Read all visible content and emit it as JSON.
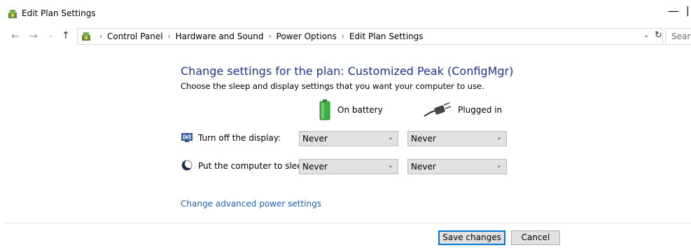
{
  "window": {
    "title": "Edit Plan Settings",
    "minimize_glyph": "—",
    "maximize_glyph": "|"
  },
  "nav": {
    "back_glyph": "←",
    "forward_glyph": "→",
    "recent_glyph": "⌄",
    "up_glyph": "↑",
    "breadcrumbs": [
      "Control Panel",
      "Hardware and Sound",
      "Power Options",
      "Edit Plan Settings"
    ],
    "separator": "›",
    "dropdown_glyph": "⌄",
    "refresh_glyph": "↻",
    "search_placeholder": "Searc"
  },
  "content": {
    "heading": "Change settings for the plan: Customized Peak (ConfigMgr)",
    "subheading": "Choose the sleep and display settings that you want your computer to use.",
    "columns": {
      "battery": "On battery",
      "plugged": "Plugged in"
    },
    "rows": [
      {
        "label": "Turn off the display:",
        "icon": "display-icon",
        "battery_value": "Never",
        "plugged_value": "Never"
      },
      {
        "label": "Put the computer to sleep:",
        "icon": "sleep-moon-icon",
        "battery_value": "Never",
        "plugged_value": "Never"
      }
    ],
    "chevron_glyph": "⌄",
    "advanced_link": "Change advanced power settings"
  },
  "footer": {
    "save_label": "Save changes",
    "cancel_label": "Cancel"
  },
  "colors": {
    "heading": "#1e3287",
    "link": "#1e5fb4",
    "primary_button_border": "#0078d7",
    "battery_green": "#3cb043"
  }
}
